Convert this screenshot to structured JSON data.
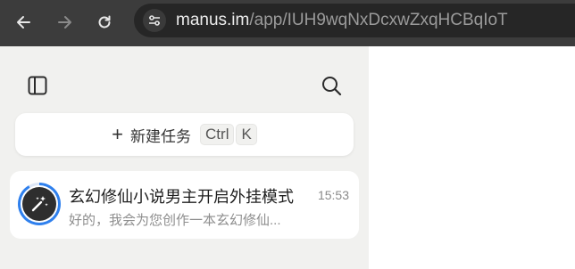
{
  "browser": {
    "back_icon": "arrow-left-icon",
    "forward_icon": "arrow-right-icon",
    "reload_icon": "reload-icon",
    "site_info_icon": "tune-icon",
    "url_host": "manus.im",
    "url_path": "/app/IUH9wqNxDcxwZxqHCBqIoT"
  },
  "sidebar": {
    "toggle_icon": "sidebar-toggle-icon",
    "search_icon": "search-icon",
    "new_task": {
      "label": "新建任务",
      "shortcut_keys": [
        "Ctrl",
        "K"
      ]
    },
    "tasks": [
      {
        "title": "玄幻修仙小说男主开启外挂模式",
        "time": "15:53",
        "preview": "好的，我会为您创作一本玄幻修仙..."
      }
    ]
  },
  "colors": {
    "toolbar_bg": "#3c3c3c",
    "sidebar_bg": "#f1f1ef",
    "accent_ring": "#2f80ed"
  }
}
